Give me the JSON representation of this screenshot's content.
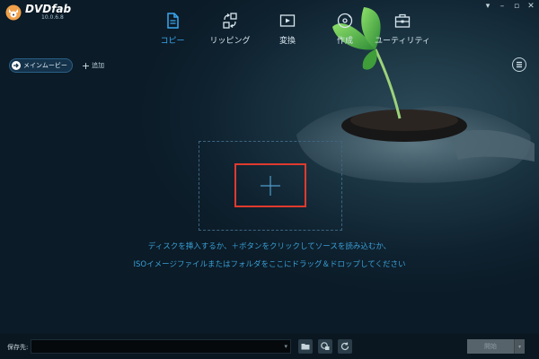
{
  "app": {
    "logo_text": "DVDfab",
    "version": "10.0.6.8"
  },
  "window_controls": [
    "pin",
    "minimize",
    "maximize",
    "close"
  ],
  "nav": {
    "active": "copy",
    "items": [
      {
        "id": "copy",
        "label": "コピー",
        "icon": "document-icon"
      },
      {
        "id": "ripping",
        "label": "リッピング",
        "icon": "convert-arrows-icon"
      },
      {
        "id": "convert",
        "label": "変換",
        "icon": "video-icon"
      },
      {
        "id": "create",
        "label": "作成",
        "icon": "disc-icon"
      },
      {
        "id": "utility",
        "label": "ユーティリティ",
        "icon": "toolbox-icon"
      }
    ]
  },
  "subtoolbar": {
    "mode_label": "メインムービー",
    "add_label": "追加"
  },
  "main": {
    "instruction_line1": "ディスクを挿入するか、＋ボタンをクリックしてソースを読み込むか、",
    "instruction_line2": "ISOイメージファイルまたはフォルダをここにドラッグ＆ドロップしてください"
  },
  "footer": {
    "save_label": "保存先:",
    "save_value": "",
    "start_label": "開始"
  },
  "colors": {
    "accent": "#3aa8f0",
    "instruction_text": "#3a9fd6",
    "highlight_box": "#e03a2e"
  }
}
